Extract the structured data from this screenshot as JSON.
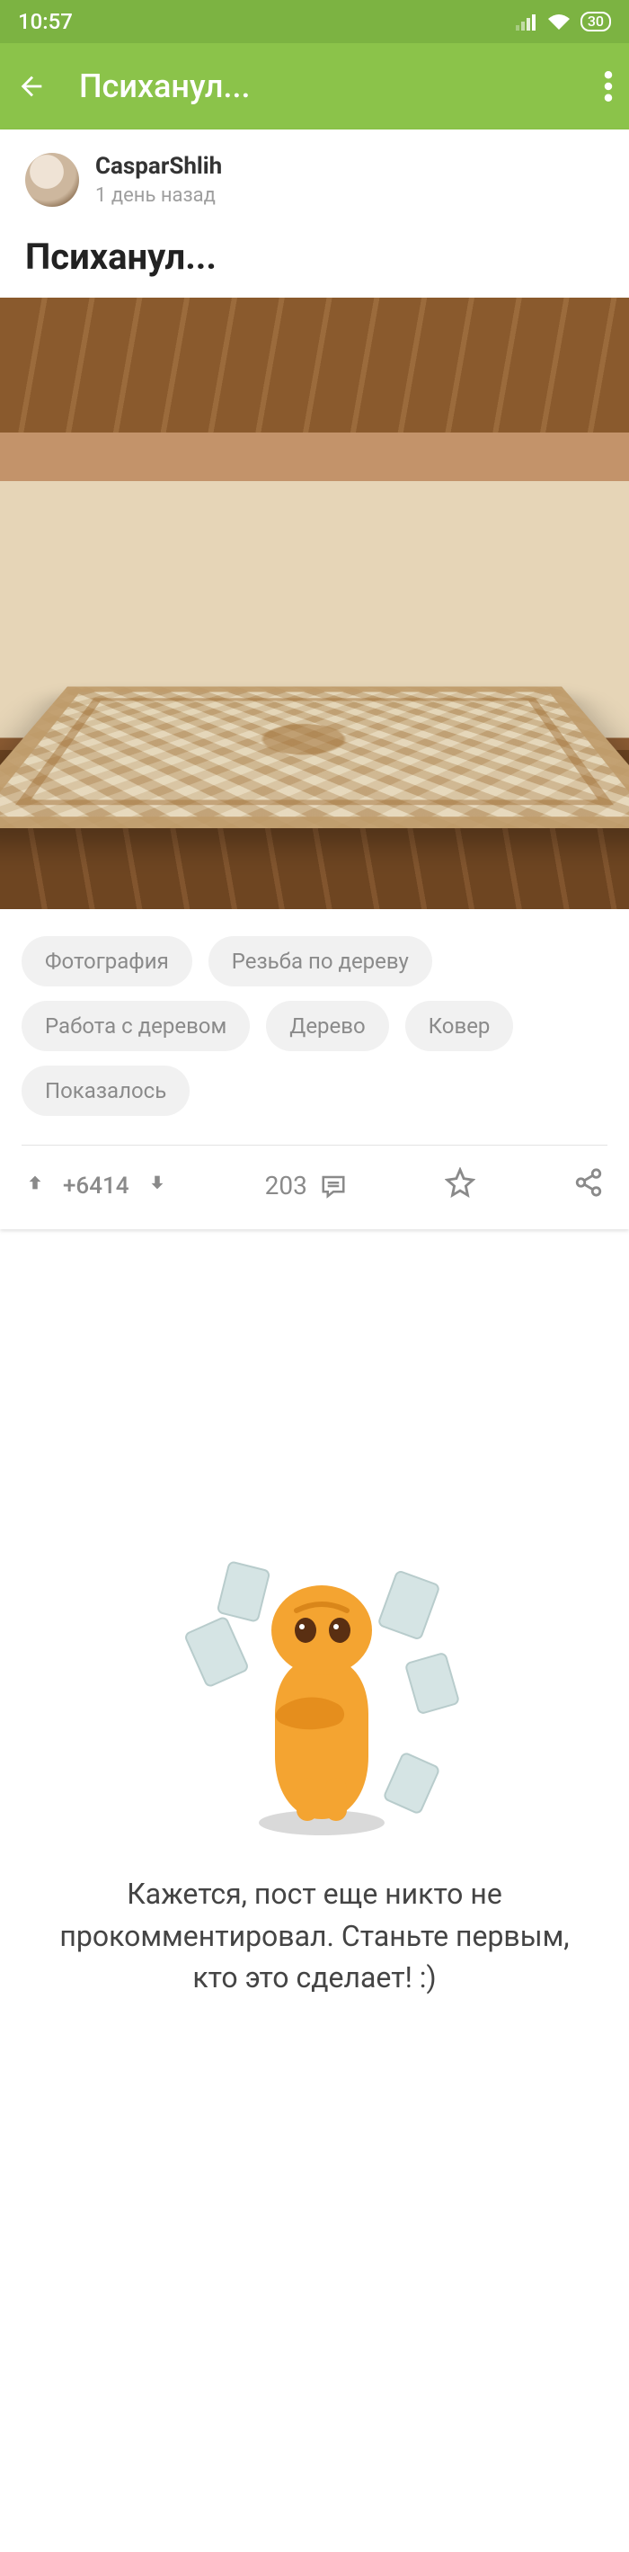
{
  "statusbar": {
    "time": "10:57",
    "battery": "30"
  },
  "appbar": {
    "title": "Психанул..."
  },
  "post": {
    "author_name": "CasparShlih",
    "author_time": "1 день назад",
    "title": "Психанул..."
  },
  "tags": [
    "Фотография",
    "Резьба по дереву",
    "Работа с деревом",
    "Дерево",
    "Ковер",
    "Показалось"
  ],
  "actions": {
    "rating": "+6414",
    "comments_count": "203"
  },
  "empty": {
    "text": "Кажется, пост еще никто не прокомментировал. Станьте первым, кто это сделает! :)"
  }
}
